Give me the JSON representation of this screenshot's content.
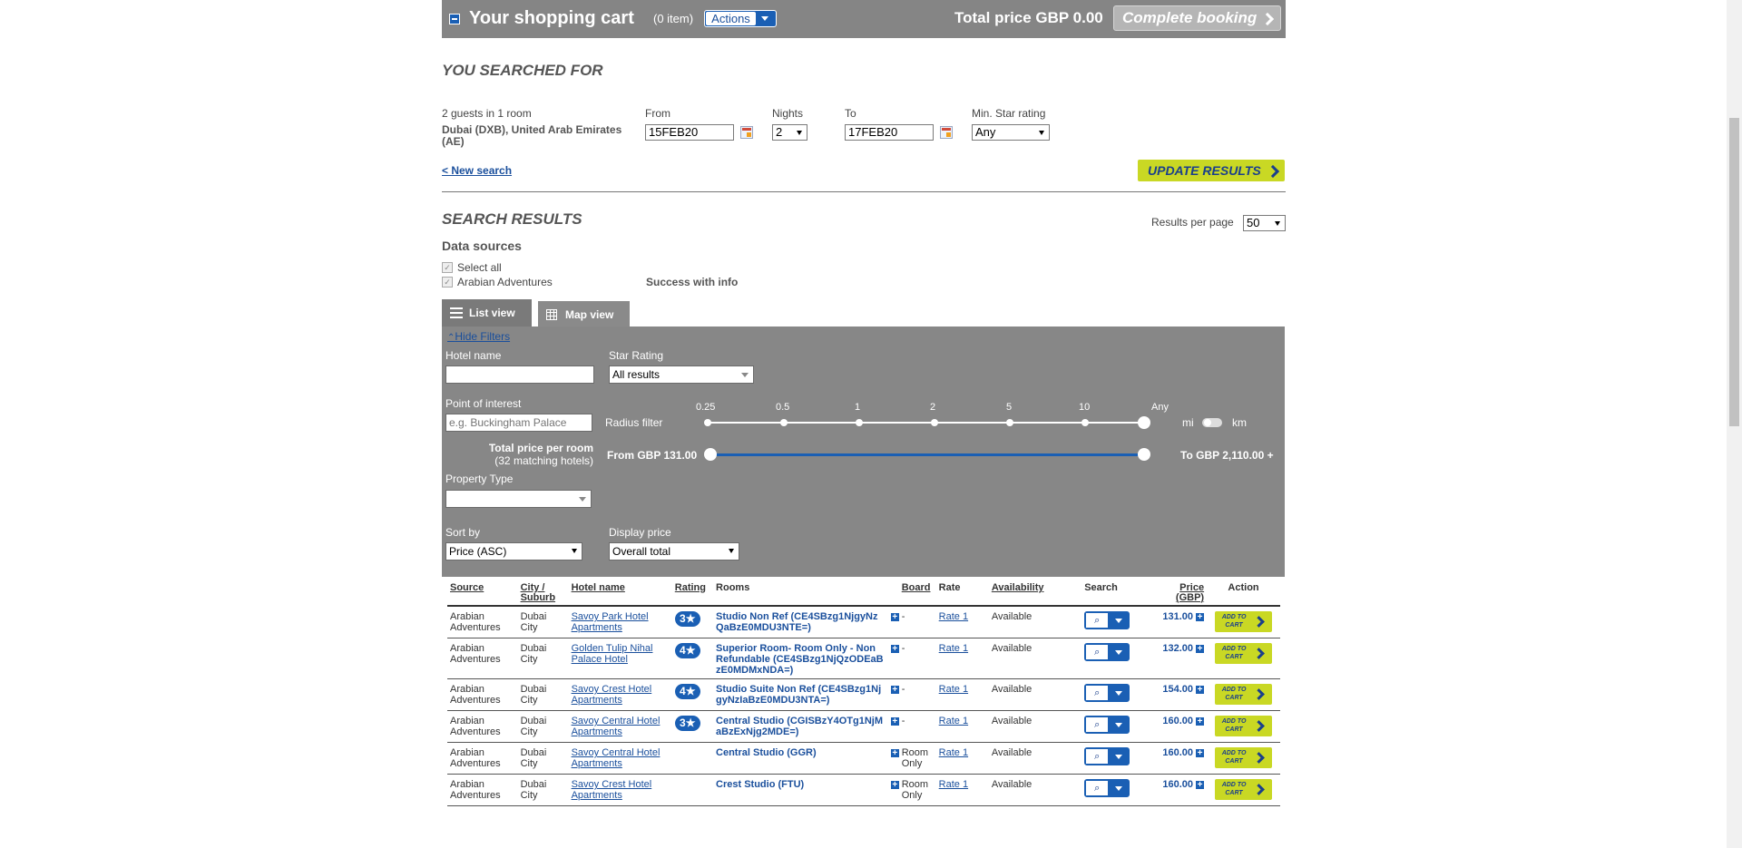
{
  "cart": {
    "title": "Your shopping cart",
    "items": "(0 item)",
    "actions_label": "Actions",
    "total_price": "Total price GBP 0.00",
    "complete_label": "Complete booking"
  },
  "search_summary": {
    "heading": "YOU SEARCHED FOR",
    "guests": "2 guests in 1 room",
    "destination": "Dubai (DXB), United Arab Emirates (AE)",
    "from_label": "From",
    "from_value": "15FEB20",
    "nights_label": "Nights",
    "nights_value": "2",
    "to_label": "To",
    "to_value": "17FEB20",
    "star_label": "Min. Star rating",
    "star_value": "Any",
    "new_search": "< New search",
    "update_label": "UPDATE RESULTS"
  },
  "results_header": {
    "heading": "SEARCH RESULTS",
    "per_page_label": "Results per page",
    "per_page_value": "50",
    "data_sources": "Data sources",
    "select_all": "Select all",
    "source_name": "Arabian Adventures",
    "source_status": "Success with info"
  },
  "tabs": {
    "list": "List view",
    "map": "Map view"
  },
  "filters": {
    "hide": "Hide Filters",
    "hotel_name_label": "Hotel name",
    "star_rating_label": "Star Rating",
    "star_rating_value": "All results",
    "poi_label": "Point of interest",
    "poi_placeholder": "e.g. Buckingham Palace",
    "radius_label": "Radius filter",
    "radius_ticks": [
      "0.25",
      "0.5",
      "1",
      "2",
      "5",
      "10",
      "Any"
    ],
    "unit_mi": "mi",
    "unit_km": "km",
    "price_label": "Total price per room",
    "matching": "(32 matching hotels)",
    "price_from": "From GBP 131.00",
    "price_to": "To GBP 2,110.00 +",
    "property_label": "Property Type",
    "sort_label": "Sort by",
    "sort_value": "Price (ASC)",
    "display_label": "Display price",
    "display_value": "Overall total"
  },
  "table": {
    "headers": {
      "source": "Source",
      "city": "City / Suburb",
      "hotel": "Hotel name",
      "rating": "Rating",
      "rooms": "Rooms",
      "board": "Board",
      "rate": "Rate",
      "availability": "Availability",
      "search": "Search",
      "price": "Price (GBP)",
      "action": "Action"
    },
    "add_to_cart": "ADD TO CART",
    "rows": [
      {
        "source": "Arabian Adventures",
        "city": "Dubai City",
        "hotel": "Savoy Park Hotel Apartments",
        "rating": "3",
        "room": "Studio Non Ref (CE4SBzg1NjgyNzQaBzE0MDU3NTE=)",
        "board": "-",
        "rate": "Rate 1",
        "availability": "Available",
        "price": "131.00"
      },
      {
        "source": "Arabian Adventures",
        "city": "Dubai City",
        "hotel": "Golden Tulip Nihal Palace Hotel",
        "rating": "4",
        "room": "Superior Room- Room Only - Non Refundable (CE4SBzg1NjQzODEaBzE0MDMxNDA=)",
        "board": "-",
        "rate": "Rate 1",
        "availability": "Available",
        "price": "132.00"
      },
      {
        "source": "Arabian Adventures",
        "city": "Dubai City",
        "hotel": "Savoy Crest Hotel Apartments",
        "rating": "4",
        "room": "Studio Suite Non Ref (CE4SBzg1NjgyNzIaBzE0MDU3NTA=)",
        "board": "-",
        "rate": "Rate 1",
        "availability": "Available",
        "price": "154.00"
      },
      {
        "source": "Arabian Adventures",
        "city": "Dubai City",
        "hotel": "Savoy Central Hotel Apartments",
        "rating": "3",
        "room": "Central Studio (CGISBzY4OTg1NjMaBzExNjg2MDE=)",
        "board": "-",
        "rate": "Rate 1",
        "availability": "Available",
        "price": "160.00"
      },
      {
        "source": "Arabian Adventures",
        "city": "Dubai City",
        "hotel": "Savoy Central Hotel Apartments",
        "rating": "",
        "room": "Central Studio (GGR)",
        "board": "Room Only",
        "rate": "Rate 1",
        "availability": "Available",
        "price": "160.00"
      },
      {
        "source": "Arabian Adventures",
        "city": "Dubai City",
        "hotel": "Savoy Crest Hotel Apartments",
        "rating": "",
        "room": "Crest Studio (FTU)",
        "board": "Room Only",
        "rate": "Rate 1",
        "availability": "Available",
        "price": "160.00"
      }
    ]
  },
  "colors": {
    "accent_blue": "#1a5fb4",
    "cta_green": "#c9d824",
    "panel_gray": "#878787"
  }
}
